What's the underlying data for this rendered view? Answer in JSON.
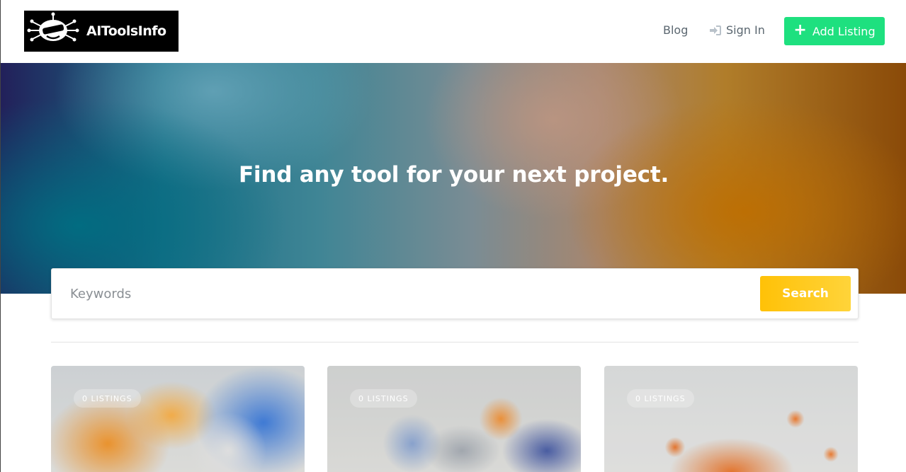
{
  "header": {
    "logo_text": "AIToolsInfo",
    "nav": {
      "blog": "Blog",
      "sign_in": "Sign In",
      "add_listing": "Add Listing"
    },
    "icons": {
      "sign_in": "sign-in-icon",
      "add_listing": "plus-icon"
    },
    "colors": {
      "add_listing_bg": "#1ee07f"
    }
  },
  "hero": {
    "title": "Find any tool for your next project."
  },
  "search": {
    "placeholder": "Keywords",
    "button_label": "Search",
    "button_color": "#ffc107"
  },
  "cards": [
    {
      "badge": "0 LISTINGS"
    },
    {
      "badge": "0 LISTINGS"
    },
    {
      "badge": "0 LISTINGS"
    }
  ]
}
